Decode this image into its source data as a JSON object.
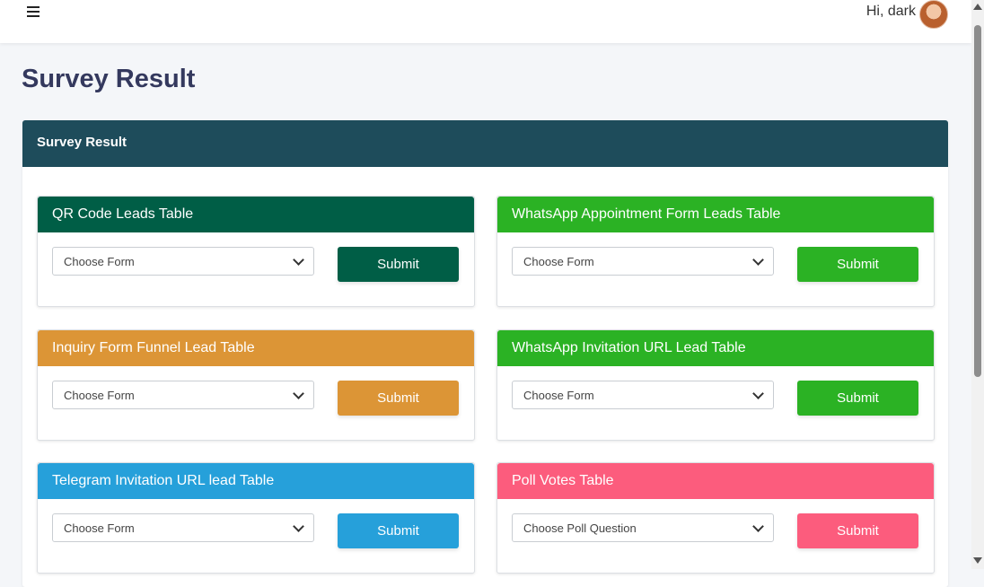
{
  "header": {
    "greeting": "Hi, dark"
  },
  "page": {
    "title": "Survey Result"
  },
  "main_card": {
    "title": "Survey Result"
  },
  "cards": [
    {
      "title": "QR Code Leads Table",
      "select_value": "Choose Form",
      "button_label": "Submit",
      "color": "#005e46"
    },
    {
      "title": "WhatsApp Appointment Form Leads Table",
      "select_value": "Choose Form",
      "button_label": "Submit",
      "color": "#2bb224"
    },
    {
      "title": "Inquiry Form Funnel Lead Table",
      "select_value": "Choose Form",
      "button_label": "Submit",
      "color": "#dc9536"
    },
    {
      "title": "WhatsApp Invitation URL Lead Table",
      "select_value": "Choose Form",
      "button_label": "Submit",
      "color": "#2bb224"
    },
    {
      "title": "Telegram Invitation URL lead Table",
      "select_value": "Choose Form",
      "button_label": "Submit",
      "color": "#26a0da"
    },
    {
      "title": "Poll Votes Table",
      "select_value": "Choose Poll Question",
      "button_label": "Submit",
      "color": "#fc5c7d"
    }
  ]
}
